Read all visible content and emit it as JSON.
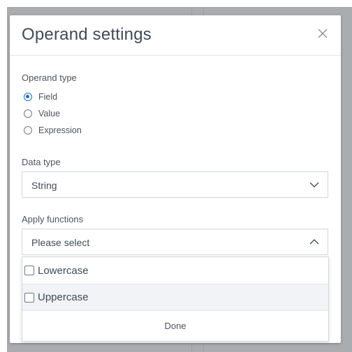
{
  "dialog": {
    "title": "Operand settings",
    "close_icon": "close-icon"
  },
  "operand_type": {
    "label": "Operand type",
    "options": [
      {
        "label": "Field",
        "selected": true
      },
      {
        "label": "Value",
        "selected": false
      },
      {
        "label": "Expression",
        "selected": false
      }
    ]
  },
  "data_type": {
    "label": "Data type",
    "value": "String",
    "chevron_icon": "chevron-down-icon"
  },
  "apply_functions": {
    "label": "Apply functions",
    "placeholder": "Please select",
    "chevron_icon": "chevron-up-icon",
    "options": [
      {
        "label": "Lowercase",
        "checked": false
      },
      {
        "label": "Uppercase",
        "checked": false
      }
    ],
    "done_label": "Done"
  },
  "colors": {
    "accent": "#1b6fd0",
    "text": "#3f4b57",
    "backdrop": "#aaadb0"
  }
}
